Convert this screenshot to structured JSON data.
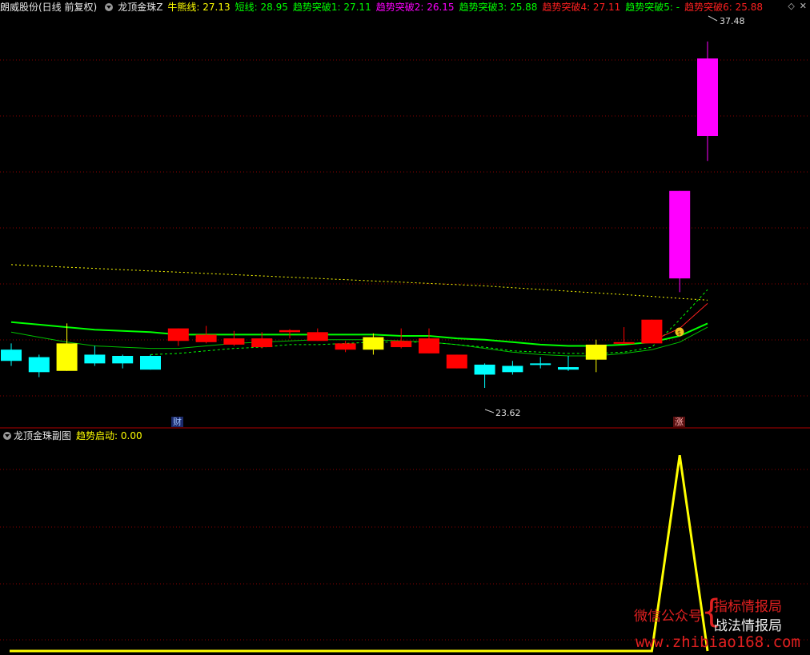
{
  "header": {
    "stock_name": "朗威股份(日线 前复权)",
    "indicator_name": "龙顶金珠Z",
    "items": [
      {
        "label": "牛熊线:",
        "value": "27.13",
        "color": "#ffff00"
      },
      {
        "label": "短线:",
        "value": "28.95",
        "color": "#00ff00"
      },
      {
        "label": "趋势突破1:",
        "value": "27.11",
        "color": "#00ff00"
      },
      {
        "label": "趋势突破2:",
        "value": "26.15",
        "color": "#ff00ff"
      },
      {
        "label": "趋势突破3:",
        "value": "25.88",
        "color": "#00ff00"
      },
      {
        "label": "趋势突破4:",
        "value": "27.11",
        "color": "#ff2020"
      },
      {
        "label": "趋势突破5:",
        "value": "-",
        "color": "#00ff00"
      },
      {
        "label": "趋势突破6:",
        "value": "25.88",
        "color": "#ff2020"
      }
    ],
    "icons": [
      "diamond-icon",
      "close-icon"
    ]
  },
  "sub_header": {
    "indicator_name": "龙顶金珠副图",
    "label": "趋势启动:",
    "value": "0.00",
    "color": "#ffff00"
  },
  "annotations": {
    "max_price": "37.48",
    "min_price": "23.62",
    "tag_cai": "财",
    "tag_zhang": "涨"
  },
  "watermark": {
    "left": "微信公众号",
    "right1": "指标情报局",
    "right2": "战法情报局",
    "url": "www.zhibiao168.com"
  },
  "colors": {
    "up_red": "#ff0000",
    "down_cyan": "#00ffff",
    "yellow": "#ffff00",
    "magenta": "#ff00ff",
    "green": "#00ff00",
    "grid": "#8b0000"
  },
  "chart_data": [
    {
      "type": "candlestick",
      "title": "",
      "ylim": [
        22.5,
        38.5
      ],
      "candles": [
        {
          "o": 25.15,
          "h": 25.4,
          "l": 24.5,
          "c": 24.7,
          "color": "cyan"
        },
        {
          "o": 24.85,
          "h": 24.95,
          "l": 24.05,
          "c": 24.25,
          "color": "cyan"
        },
        {
          "o": 24.3,
          "h": 26.2,
          "l": 24.3,
          "c": 25.4,
          "color": "yellow"
        },
        {
          "o": 24.95,
          "h": 25.3,
          "l": 24.5,
          "c": 24.6,
          "color": "cyan"
        },
        {
          "o": 24.9,
          "h": 24.95,
          "l": 24.4,
          "c": 24.6,
          "color": "cyan"
        },
        {
          "o": 24.9,
          "h": 24.95,
          "l": 24.35,
          "c": 24.35,
          "color": "cyan"
        },
        {
          "o": 25.5,
          "h": 26.0,
          "l": 25.3,
          "c": 26.0,
          "color": "red"
        },
        {
          "o": 25.45,
          "h": 26.1,
          "l": 25.4,
          "c": 25.75,
          "color": "red"
        },
        {
          "o": 25.35,
          "h": 25.9,
          "l": 25.3,
          "c": 25.6,
          "color": "red"
        },
        {
          "o": 25.25,
          "h": 25.85,
          "l": 25.2,
          "c": 25.6,
          "color": "red"
        },
        {
          "o": 25.85,
          "h": 25.97,
          "l": 25.6,
          "c": 25.93,
          "color": "red"
        },
        {
          "o": 25.5,
          "h": 26.0,
          "l": 25.5,
          "c": 25.85,
          "color": "red"
        },
        {
          "o": 25.15,
          "h": 25.5,
          "l": 25.05,
          "c": 25.4,
          "color": "red"
        },
        {
          "o": 25.65,
          "h": 25.8,
          "l": 24.95,
          "c": 25.15,
          "color": "yellow"
        },
        {
          "o": 25.25,
          "h": 26.0,
          "l": 25.2,
          "c": 25.5,
          "color": "red"
        },
        {
          "o": 25.0,
          "h": 26.0,
          "l": 25.0,
          "c": 25.6,
          "color": "red"
        },
        {
          "o": 24.4,
          "h": 24.95,
          "l": 24.4,
          "c": 24.95,
          "color": "red"
        },
        {
          "o": 24.55,
          "h": 24.6,
          "l": 23.62,
          "c": 24.15,
          "color": "cyan"
        },
        {
          "o": 24.5,
          "h": 24.7,
          "l": 24.15,
          "c": 24.25,
          "color": "cyan"
        },
        {
          "o": 24.6,
          "h": 24.85,
          "l": 24.4,
          "c": 24.55,
          "color": "cyan"
        },
        {
          "o": 24.45,
          "h": 24.9,
          "l": 24.3,
          "c": 24.35,
          "color": "cyan"
        },
        {
          "o": 24.75,
          "h": 25.55,
          "l": 24.25,
          "c": 25.35,
          "color": "yellow"
        },
        {
          "o": 25.4,
          "h": 26.05,
          "l": 25.4,
          "c": 25.45,
          "color": "red"
        },
        {
          "o": 25.4,
          "h": 26.35,
          "l": 25.4,
          "c": 26.35,
          "color": "red"
        },
        {
          "o": 28.0,
          "h": 31.5,
          "l": 27.45,
          "c": 31.5,
          "color": "magenta"
        },
        {
          "o": 33.7,
          "h": 37.48,
          "l": 32.7,
          "c": 36.8,
          "color": "magenta"
        }
      ],
      "lines": [
        {
          "name": "牛熊线",
          "color": "#ffff00",
          "dash": "2,3",
          "values": [
            28.55,
            28.5,
            28.45,
            28.4,
            28.35,
            28.3,
            28.25,
            28.2,
            28.15,
            28.1,
            28.05,
            28.0,
            27.95,
            27.9,
            27.85,
            27.8,
            27.75,
            27.7,
            27.63,
            27.56,
            27.49,
            27.42,
            27.35,
            27.28,
            27.2,
            27.13
          ]
        },
        {
          "name": "短线",
          "color": "#00ff00",
          "dash": "",
          "values": [
            26.25,
            26.15,
            26.05,
            25.95,
            25.9,
            25.85,
            25.75,
            25.75,
            25.75,
            25.75,
            25.75,
            25.75,
            25.75,
            25.75,
            25.7,
            25.7,
            25.6,
            25.55,
            25.45,
            25.35,
            25.3,
            25.3,
            25.35,
            25.45,
            25.7,
            26.2
          ]
        },
        {
          "name": "趋势突破1",
          "color": "#00c000",
          "dash": "",
          "values": [
            25.85,
            25.65,
            25.45,
            25.3,
            25.25,
            25.2,
            25.2,
            25.3,
            25.4,
            25.45,
            25.5,
            25.55,
            25.55,
            25.55,
            25.5,
            25.45,
            25.35,
            25.2,
            25.05,
            24.95,
            24.9,
            24.9,
            25.0,
            25.15,
            25.45,
            26.05
          ]
        },
        {
          "name": "趋势突破3",
          "color": "#00ff00",
          "dash": "3,3",
          "values": [
            null,
            null,
            null,
            null,
            null,
            24.95,
            25.0,
            25.1,
            25.2,
            25.25,
            25.35,
            25.35,
            25.4,
            25.45,
            25.45,
            25.45,
            25.35,
            25.25,
            25.1,
            25.05,
            25.0,
            25.0,
            25.05,
            25.25,
            26.35,
            27.55
          ]
        },
        {
          "name": "趋势突破4",
          "color": "#ff2020",
          "dash": "",
          "values": [
            null,
            null,
            null,
            null,
            null,
            null,
            null,
            null,
            null,
            null,
            null,
            null,
            null,
            null,
            null,
            null,
            null,
            null,
            null,
            null,
            null,
            null,
            null,
            25.5,
            26.0,
            27.0
          ]
        }
      ]
    },
    {
      "type": "line",
      "title": "",
      "series": [
        {
          "name": "趋势启动",
          "color": "#ffff00",
          "values": [
            0,
            0,
            0,
            0,
            0,
            0,
            0,
            0,
            0,
            0,
            0,
            0,
            0,
            0,
            0,
            0,
            0,
            0,
            0,
            0,
            0,
            0,
            0,
            0,
            1,
            0
          ]
        }
      ],
      "ylim": [
        0,
        1.05
      ]
    }
  ]
}
